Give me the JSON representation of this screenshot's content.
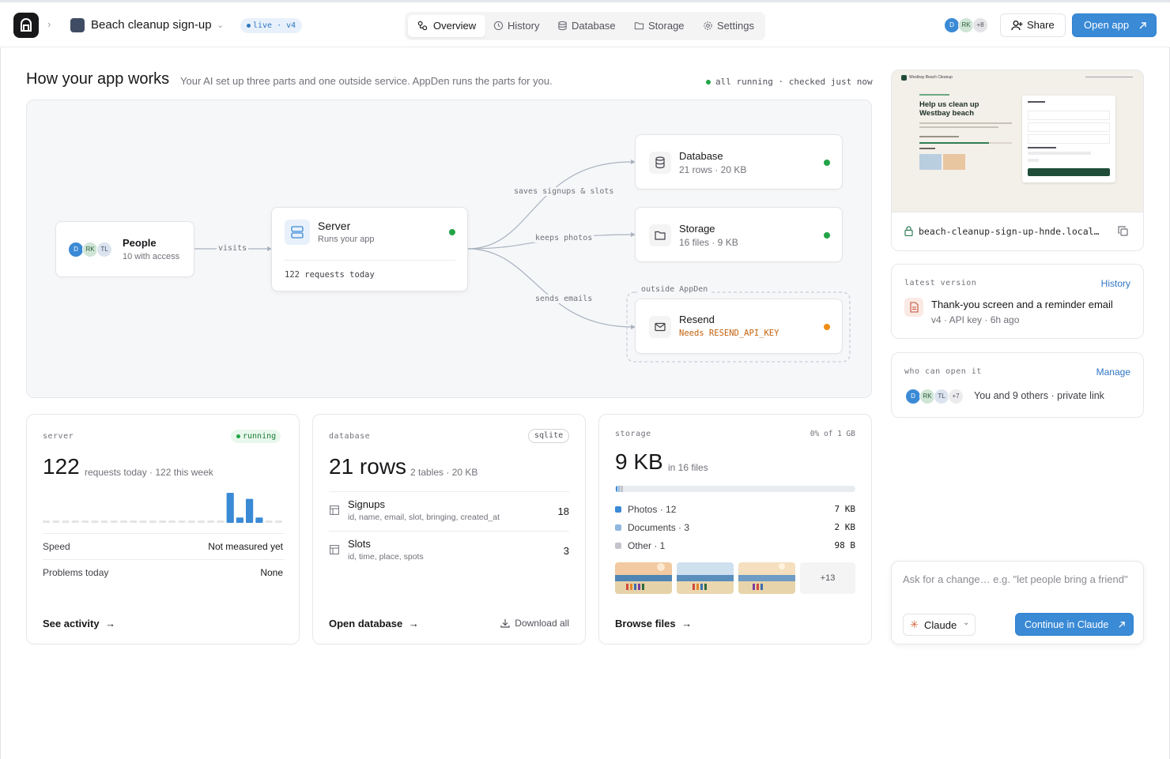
{
  "header": {
    "app_name": "Beach cleanup sign-up",
    "badge": "live · v4",
    "tabs": [
      {
        "label": "Overview",
        "icon": "overview-icon"
      },
      {
        "label": "History",
        "icon": "history-icon"
      },
      {
        "label": "Database",
        "icon": "database-icon"
      },
      {
        "label": "Storage",
        "icon": "folder-icon"
      },
      {
        "label": "Settings",
        "icon": "gear-icon"
      }
    ],
    "avatars": [
      "D",
      "RK",
      "+8"
    ],
    "share_label": "Share",
    "open_app_label": "Open app"
  },
  "overview": {
    "title": "How your app works",
    "subtitle": "Your AI set up three parts and one outside service. AppDen runs the parts for you.",
    "status": "all running · checked just now"
  },
  "diagram": {
    "people": {
      "title": "People",
      "sub": "10 with access",
      "avatars": [
        "D",
        "RK",
        "TL"
      ]
    },
    "edge_visits": "visits",
    "server": {
      "title": "Server",
      "sub": "Runs your app",
      "footer": "122 requests today"
    },
    "edge_saves": "saves signups & slots",
    "edge_photos": "keeps photos",
    "edge_emails": "sends emails",
    "database": {
      "title": "Database",
      "sub": "21 rows · 20 KB"
    },
    "storage": {
      "title": "Storage",
      "sub": "16 files · 9 KB"
    },
    "outside_label": "outside AppDen",
    "resend": {
      "title": "Resend",
      "sub": "Needs RESEND_API_KEY"
    }
  },
  "server_card": {
    "kicker": "server",
    "status": "running",
    "value": "122",
    "value_sub": "requests today · 122 this week",
    "bars": [
      0,
      0,
      0,
      0,
      0,
      0,
      0,
      0,
      0,
      0,
      0,
      0,
      0,
      0,
      0,
      0,
      0,
      0,
      0,
      1.0,
      0.18,
      0.8,
      0.18,
      0,
      0
    ],
    "rows": [
      {
        "label": "Speed",
        "value": "Not measured yet"
      },
      {
        "label": "Problems today",
        "value": "None"
      }
    ],
    "link": "See activity"
  },
  "database_card": {
    "kicker": "database",
    "badge": "sqlite",
    "value": "21 rows",
    "value_sub": "2 tables · 20 KB",
    "tables": [
      {
        "name": "Signups",
        "cols": "id, name, email, slot, bringing, created_at",
        "count": "18"
      },
      {
        "name": "Slots",
        "cols": "id, time, place, spots",
        "count": "3"
      }
    ],
    "link": "Open database",
    "download": "Download all"
  },
  "storage_card": {
    "kicker": "storage",
    "usage": "0% of 1 GB",
    "value": "9 KB",
    "value_sub": "in 16 files",
    "segments": [
      {
        "label": "Photos · 12",
        "size": "7 KB",
        "color": "#3a8ad6"
      },
      {
        "label": "Documents · 3",
        "size": "2 KB",
        "color": "#8fb8e0"
      },
      {
        "label": "Other · 1",
        "size": "98 B",
        "color": "#c4c4cc"
      }
    ],
    "more": "+13",
    "link": "Browse files"
  },
  "preview": {
    "site_brand": "Westbay Beach Cleanup",
    "site_headline": "Help us clean up Westbay beach",
    "url": "beach-cleanup-sign-up-hnde.local…"
  },
  "latest": {
    "kicker": "latest version",
    "link": "History",
    "title": "Thank-you screen and a reminder email",
    "sub": "v4 · API key · 6h ago"
  },
  "access": {
    "kicker": "who can open it",
    "link": "Manage",
    "avatars": [
      "D",
      "RK",
      "TL",
      "+7"
    ],
    "text": "You and 9 others · private link"
  },
  "composer": {
    "placeholder": "Ask for a change… e.g. \"let people bring a friend\"",
    "model": "Claude",
    "action": "Continue in Claude"
  },
  "colors": {
    "accent": "#3a8ad6",
    "green": "#22a447",
    "orange": "#ef8c15"
  }
}
